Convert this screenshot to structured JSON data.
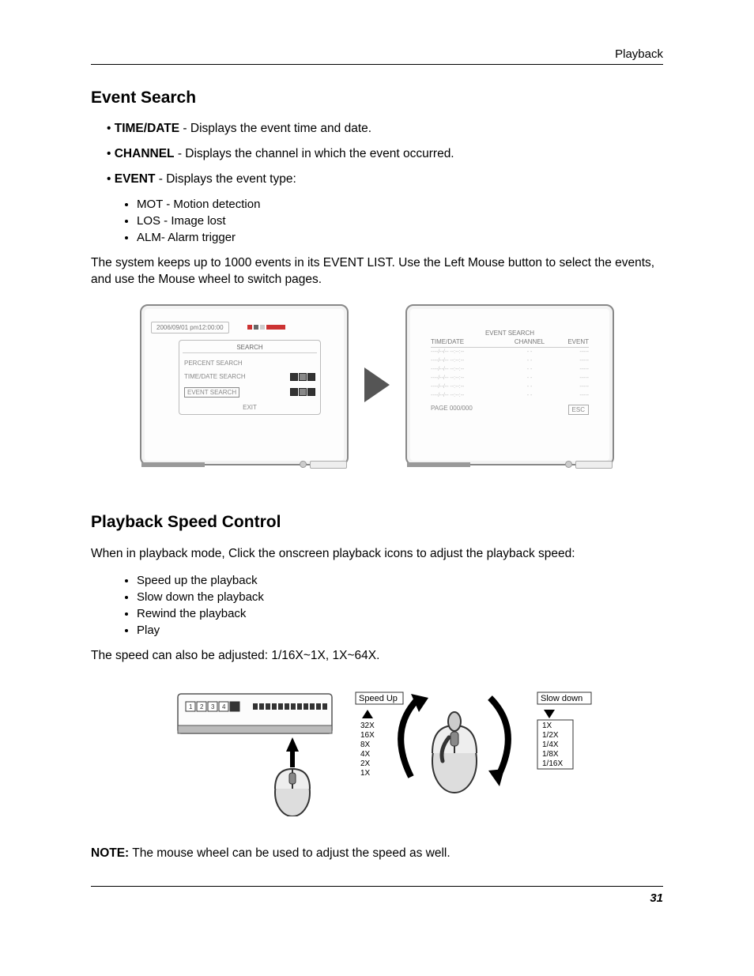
{
  "header": {
    "section": "Playback"
  },
  "eventSearch": {
    "title": "Event Search",
    "items": [
      {
        "label": "TIME/DATE",
        "desc": " - Displays the event time and date."
      },
      {
        "label": "CHANNEL",
        "desc": " - Displays the channel in which the event occurred."
      },
      {
        "label": "EVENT",
        "desc": " - Displays the event type:"
      }
    ],
    "eventTypes": [
      "MOT - Motion detection",
      "LOS - Image lost",
      "ALM- Alarm trigger"
    ],
    "paragraph": "The system keeps up to 1000 events in its EVENT LIST. Use the Left Mouse button to select the events, and use the Mouse wheel to switch pages."
  },
  "figure1": {
    "left": {
      "datetime": "2006/09/01 pm12:00:00",
      "menuTitle": "SEARCH",
      "menuItems": [
        "PERCENT SEARCH",
        "TIME/DATE SEARCH",
        "EVENT SEARCH"
      ],
      "exit": "EXIT"
    },
    "right": {
      "title": "EVENT SEARCH",
      "cols": [
        "TIME/DATE",
        "CHANNEL",
        "EVENT"
      ],
      "page": "PAGE  000/000",
      "esc": "ESC"
    }
  },
  "playbackSpeed": {
    "title": "Playback Speed Control",
    "intro": "When in playback mode, Click the onscreen playback icons to adjust the playback speed:",
    "items": [
      "Speed up the playback",
      "Slow down the playback",
      "Rewind the playback",
      "Play"
    ],
    "range": "The speed can also be adjusted: 1/16X~1X, 1X~64X.",
    "noteLabel": "NOTE:",
    "noteText": " The mouse wheel can be used to adjust the speed as well."
  },
  "figure2": {
    "speedUp": {
      "label": "Speed Up",
      "values": [
        "32X",
        "16X",
        "8X",
        "4X",
        "2X",
        "1X"
      ]
    },
    "slowDown": {
      "label": "Slow down",
      "values": [
        "1X",
        "1/2X",
        "1/4X",
        "1/8X",
        "1/16X"
      ]
    }
  },
  "pageNumber": "31"
}
